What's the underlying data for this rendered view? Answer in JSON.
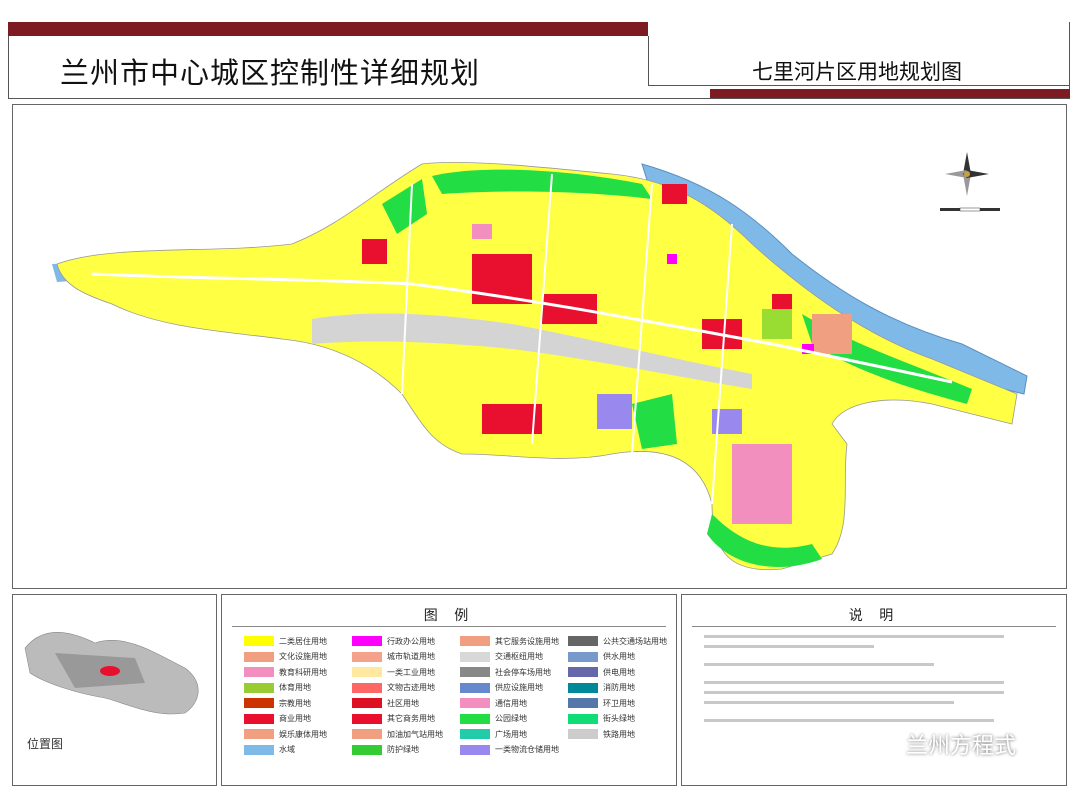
{
  "header": {
    "main_title": "兰州市中心城区控制性详细规划",
    "sub_title": "七里河片区用地规划图"
  },
  "colors": {
    "accent_bar": "#7d1a22",
    "residential": "#ffff00",
    "commercial": "#e8102e",
    "green": "#22dd44",
    "river": "#7fb9e8",
    "rail": "#cccccc",
    "education": "#f28fbf",
    "admin": "#ff00ff",
    "park": "#99dd33"
  },
  "map": {
    "compass_icon": "north-arrow-icon",
    "scale_icon": "scale-bar-icon"
  },
  "legend": {
    "title": "图 例",
    "items": [
      {
        "label": "二类居住用地",
        "color": "#ffff00"
      },
      {
        "label": "文化设施用地",
        "color": "#f0a080"
      },
      {
        "label": "教育科研用地",
        "color": "#f28fbf"
      },
      {
        "label": "体育用地",
        "color": "#99cc33"
      },
      {
        "label": "宗教用地",
        "color": "#cc3300"
      },
      {
        "label": "商业用地",
        "color": "#e8102e"
      },
      {
        "label": "娱乐康体用地",
        "color": "#f0a080"
      },
      {
        "label": "水域",
        "color": "#7fb9e8"
      },
      {
        "label": "行政办公用地",
        "color": "#ff00ff"
      },
      {
        "label": "城市轨道用地",
        "color": "#f4a28c"
      },
      {
        "label": "一类工业用地",
        "color": "#ffe9a0"
      },
      {
        "label": "文物古迹用地",
        "color": "#ff6666"
      },
      {
        "label": "社区用地",
        "color": "#dd1122"
      },
      {
        "label": "其它商务用地",
        "color": "#e8102e"
      },
      {
        "label": "加油加气站用地",
        "color": "#f0a080"
      },
      {
        "label": "防护绿地",
        "color": "#33cc33"
      },
      {
        "label": "其它服务设施用地",
        "color": "#f0a080"
      },
      {
        "label": "交通枢纽用地",
        "color": "#d8d8d8"
      },
      {
        "label": "社会停车场用地",
        "color": "#888888"
      },
      {
        "label": "供应设施用地",
        "color": "#6688cc"
      },
      {
        "label": "通信用地",
        "color": "#f28fbf"
      },
      {
        "label": "公园绿地",
        "color": "#22dd44"
      },
      {
        "label": "广场用地",
        "color": "#22ccaa"
      },
      {
        "label": "一类物流仓储用地",
        "color": "#9988ee"
      },
      {
        "label": "公共交通场站用地",
        "color": "#666666"
      },
      {
        "label": "供水用地",
        "color": "#7799cc"
      },
      {
        "label": "供电用地",
        "color": "#6666aa"
      },
      {
        "label": "消防用地",
        "color": "#008899"
      },
      {
        "label": "环卫用地",
        "color": "#5577aa"
      },
      {
        "label": "街头绿地",
        "color": "#11dd77"
      },
      {
        "label": "铁路用地",
        "color": "#cccccc"
      }
    ]
  },
  "notes": {
    "title": "说 明"
  },
  "locator": {
    "caption": "位置图"
  },
  "watermark": {
    "text": "兰州方程式",
    "icon": "wechat-icon"
  }
}
